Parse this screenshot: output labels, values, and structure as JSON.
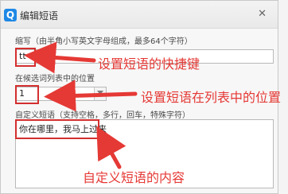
{
  "window": {
    "title": "编辑短语",
    "app_icon": "Q",
    "close_glyph": "✕"
  },
  "form": {
    "shortcut_label": "缩写（由半角小写英文字母组成，最多64个字符）",
    "shortcut_value": "tt",
    "position_label": "在候选词列表中的位置",
    "position_value": "1",
    "phrase_label": "自定义短语（支持空格，多行，回车，特殊字符）",
    "phrase_value": "你在哪里，我马上过来"
  },
  "annotations": {
    "shortcut_note": "设置短语的快捷键",
    "position_note": "设置短语在列表中的位置",
    "content_note": "自定义短语的内容",
    "color": "#e53935"
  }
}
